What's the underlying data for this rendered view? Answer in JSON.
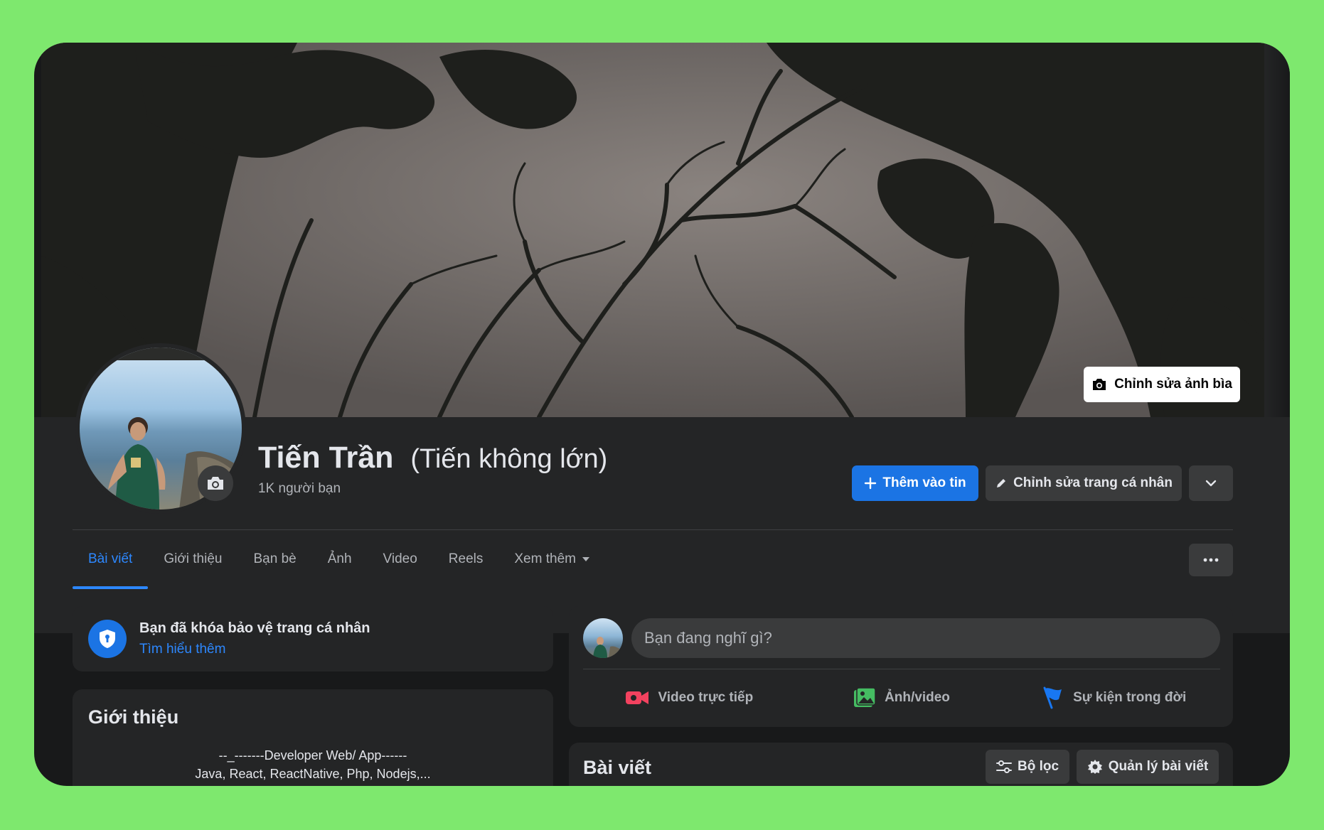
{
  "profile": {
    "name": "Tiến Trần",
    "alternate_name": "(Tiến không lớn)",
    "friends_count": "1K người bạn"
  },
  "cover": {
    "edit_label": "Chỉnh sửa ảnh bìa"
  },
  "actions": {
    "add_to_story": "Thêm vào tin",
    "edit_profile": "Chỉnh sửa trang cá nhân"
  },
  "tabs": [
    {
      "label": "Bài viết",
      "active": true
    },
    {
      "label": "Giới thiệu"
    },
    {
      "label": "Bạn bè"
    },
    {
      "label": "Ảnh"
    },
    {
      "label": "Video"
    },
    {
      "label": "Reels"
    },
    {
      "label": "Xem thêm"
    }
  ],
  "lock_notice": {
    "title": "Bạn đã khóa bảo vệ trang cá nhân",
    "link": "Tìm hiểu thêm"
  },
  "intro": {
    "title": "Giới thiệu",
    "bio_line1": "--_-------Developer Web/ App------",
    "bio_line2": "Java, React, ReactNative, Php, Nodejs,..."
  },
  "composer": {
    "placeholder": "Bạn đang nghĩ gì?",
    "live_video": "Video trực tiếp",
    "photo_video": "Ảnh/video",
    "life_event": "Sự kiện trong đời"
  },
  "posts": {
    "title": "Bài viết",
    "filter_label": "Bộ lọc",
    "manage_label": "Quản lý bài viết"
  },
  "colors": {
    "accent": "#1b74e4",
    "link": "#2d88ff",
    "card": "#242526",
    "background": "#18191a",
    "live_red": "#f3425f",
    "photo_green": "#45bd62",
    "event_blue": "#1877f2",
    "outer_green": "#7ee86e"
  }
}
